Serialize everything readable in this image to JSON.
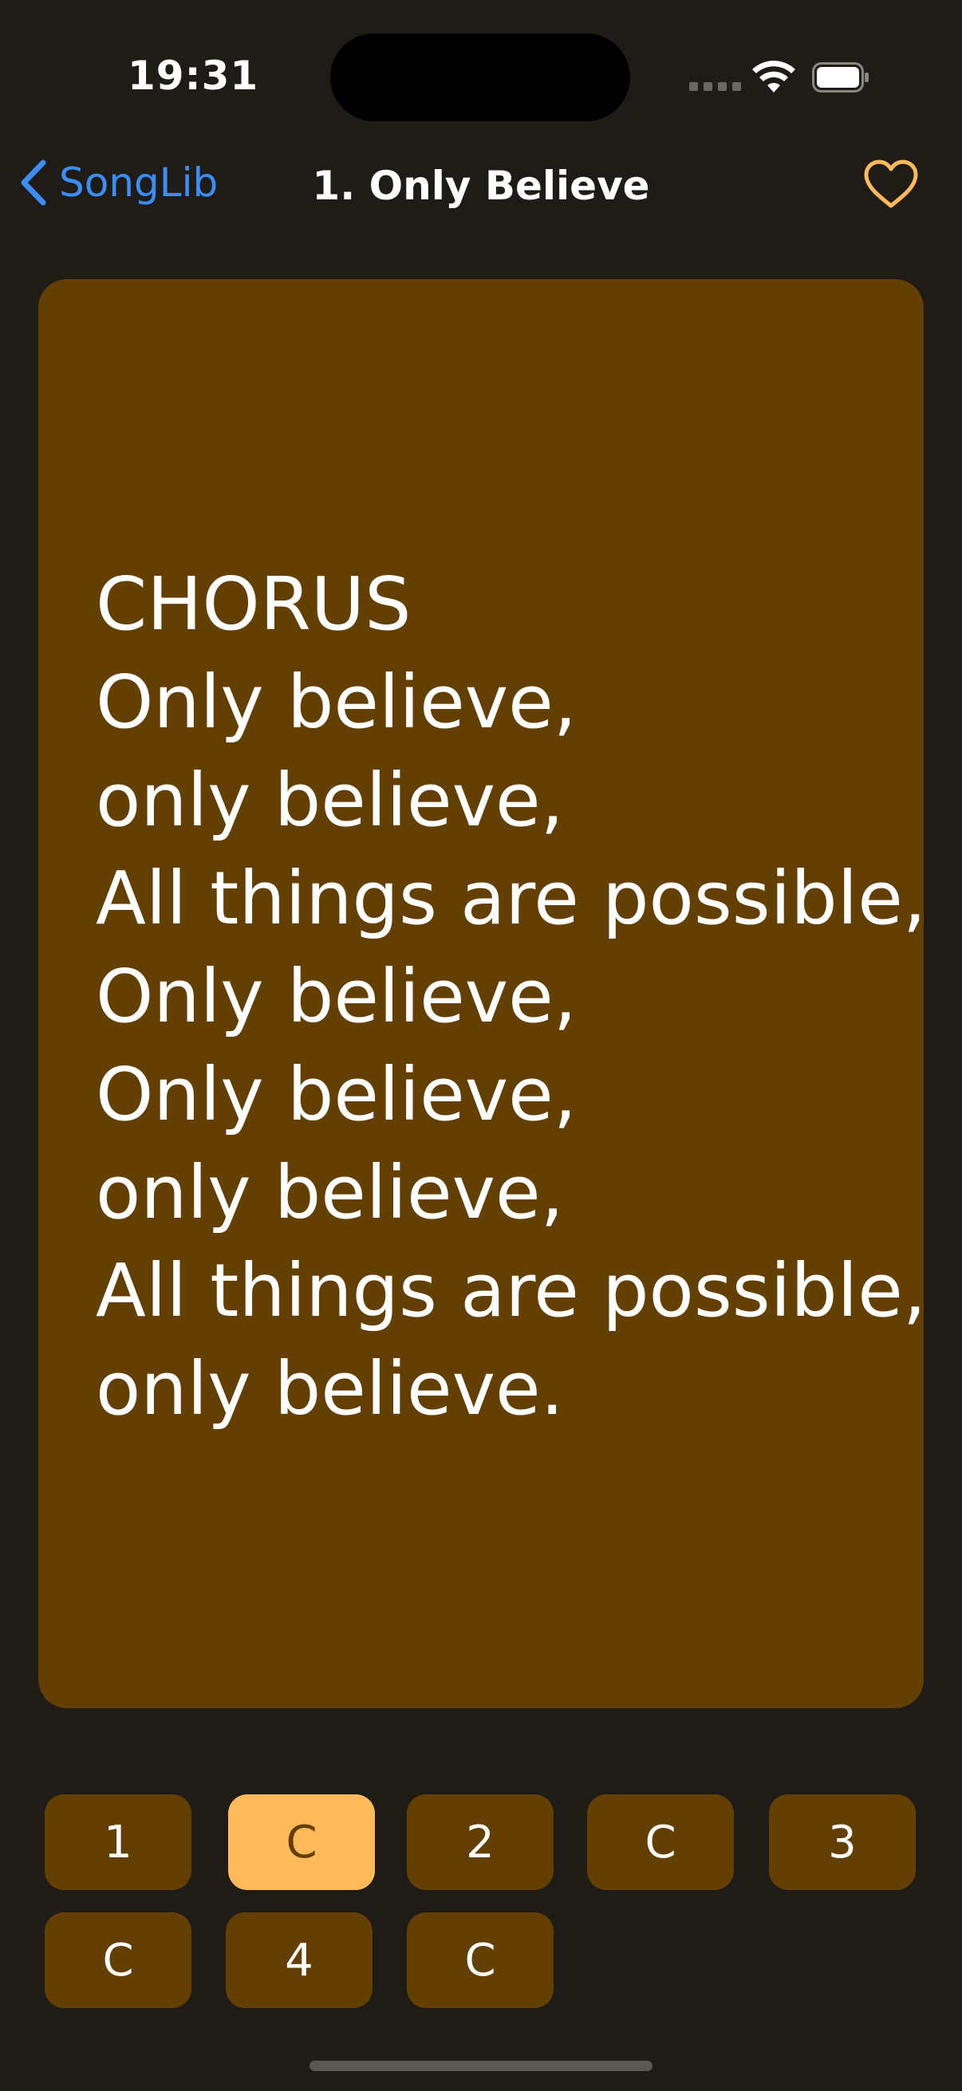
{
  "status_bar": {
    "time": "19:31"
  },
  "nav": {
    "back_label": "SongLib",
    "title": "1. Only Believe",
    "favorite_icon": "heart-icon"
  },
  "lyrics": {
    "text": "CHORUS\nOnly believe,\nonly believe,\nAll things are possible,\nOnly believe,\nOnly believe,\nonly believe,\nAll things are possible,\nonly believe."
  },
  "sections": {
    "items": [
      {
        "label": "1",
        "active": false
      },
      {
        "label": "C",
        "active": true
      },
      {
        "label": "2",
        "active": false
      },
      {
        "label": "C",
        "active": false
      },
      {
        "label": "3",
        "active": false
      },
      {
        "label": "C",
        "active": false
      },
      {
        "label": "4",
        "active": false
      },
      {
        "label": "C",
        "active": false
      }
    ]
  },
  "colors": {
    "background": "#1f1b17",
    "card": "#633f02",
    "accent": "#fdb95a",
    "link": "#3a8ef6"
  }
}
